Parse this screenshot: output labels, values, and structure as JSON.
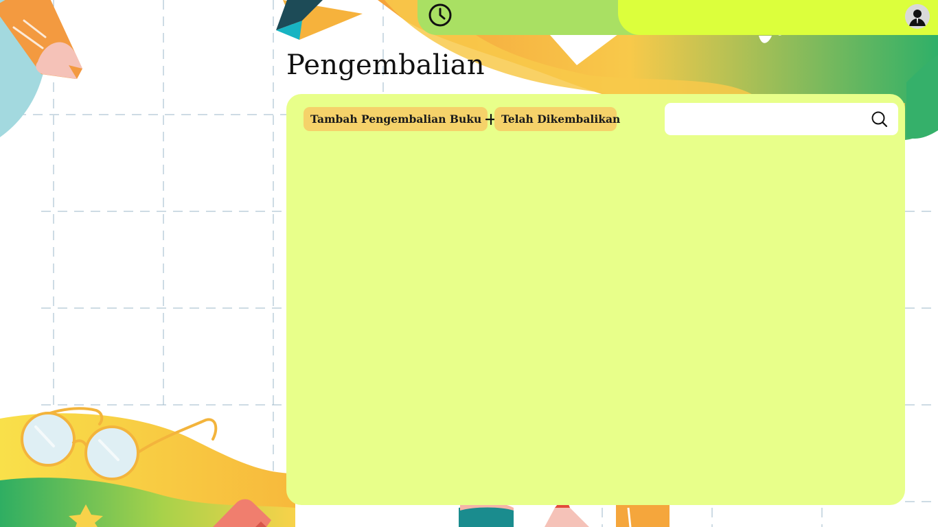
{
  "page": {
    "title": "Pengembalian"
  },
  "topbar": {
    "history_icon": "clock-icon",
    "profile_icon": "user-avatar-icon"
  },
  "toolbar": {
    "add_return_label": "Tambah Pengembalian Buku",
    "add_return_icon": "plus-icon",
    "returned_label": "Telah Dikembalikan"
  },
  "search": {
    "value": "",
    "placeholder": "",
    "icon": "search-icon"
  },
  "colors": {
    "panel": "#e8ff8a",
    "button": "#f5d26a",
    "topbar_green": "#a9e063",
    "topbar_yellow": "#dcff3c"
  }
}
